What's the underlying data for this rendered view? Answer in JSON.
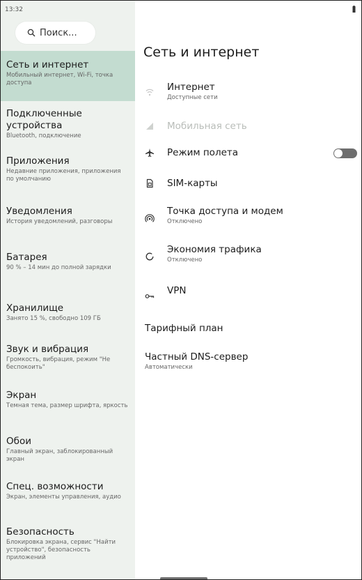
{
  "status_bar": {
    "time": "13:32",
    "battery_icon": "battery-icon"
  },
  "sidebar": {
    "search": {
      "placeholder": "Поиск...",
      "icon": "search-icon"
    },
    "items": [
      {
        "title": "Сеть и интернет",
        "subtitle": "Мобильный интернет, Wi-Fi, точка доступа",
        "active": true
      },
      {
        "title": "Подключенные устройства",
        "subtitle": "Bluetooth, подключение"
      },
      {
        "title": "Приложения",
        "subtitle": "Недавние приложения, приложения по умолчанию"
      },
      {
        "title": "Уведомления",
        "subtitle": "История уведомлений, разговоры"
      },
      {
        "title": "Батарея",
        "subtitle": "90 % – 14 мин до полной зарядки"
      },
      {
        "title": "Хранилище",
        "subtitle": "Занято 15 %, свободно 109 ГБ"
      },
      {
        "title": "Звук и вибрация",
        "subtitle": "Громкость, вибрация, режим \"Не беспокоить\""
      },
      {
        "title": "Экран",
        "subtitle": "Темная тема, размер шрифта, яркость"
      },
      {
        "title": "Обои",
        "subtitle": "Главный экран, заблокированный экран"
      },
      {
        "title": "Спец. возможности",
        "subtitle": "Экран, элементы управления, аудио"
      },
      {
        "title": "Безопасность",
        "subtitle": "Блокировка экрана, сервис \"Найти устройство\", безопасность приложений"
      }
    ]
  },
  "main": {
    "title": "Сеть и интернет",
    "rows": [
      {
        "title": "Интернет",
        "subtitle": "Доступные сети",
        "icon": "wifi-icon"
      },
      {
        "title": "Мобильная сеть",
        "icon": "signal-icon",
        "disabled": true
      },
      {
        "title": "Режим полета",
        "icon": "airplane-icon",
        "toggle": false
      },
      {
        "title": "SIM-карты",
        "icon": "sim-card-icon"
      },
      {
        "title": "Точка доступа и модем",
        "subtitle": "Отключено",
        "icon": "hotspot-icon"
      },
      {
        "title": "Экономия трафика",
        "subtitle": "Отключено",
        "icon": "data-saver-icon"
      },
      {
        "title": "VPN",
        "icon": "vpn-key-icon"
      }
    ],
    "plain_rows": [
      {
        "title": "Тарифный план"
      },
      {
        "title": "Частный DNS-сервер",
        "subtitle": "Автоматически"
      }
    ]
  },
  "colors": {
    "sidebar_bg": "#eef2ee",
    "active_item_bg": "#c3dcd0",
    "toggle_track": "#6e6e6e",
    "disabled_text": "#b9bdb9"
  }
}
